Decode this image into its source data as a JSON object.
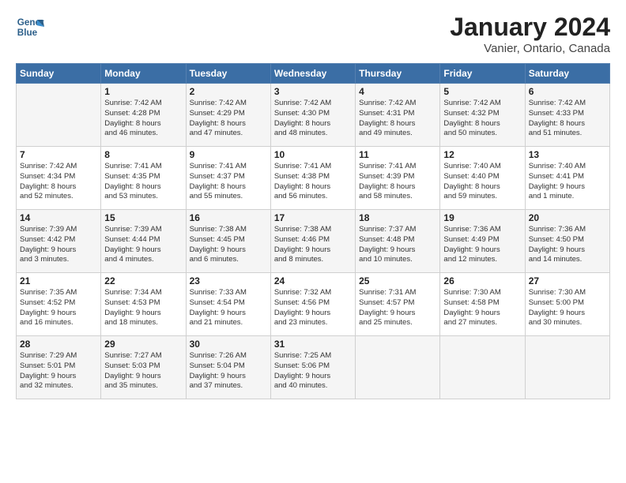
{
  "header": {
    "logo_line1": "General",
    "logo_line2": "Blue",
    "month": "January 2024",
    "location": "Vanier, Ontario, Canada"
  },
  "columns": [
    "Sunday",
    "Monday",
    "Tuesday",
    "Wednesday",
    "Thursday",
    "Friday",
    "Saturday"
  ],
  "weeks": [
    [
      {
        "day": "",
        "info": ""
      },
      {
        "day": "1",
        "info": "Sunrise: 7:42 AM\nSunset: 4:28 PM\nDaylight: 8 hours\nand 46 minutes."
      },
      {
        "day": "2",
        "info": "Sunrise: 7:42 AM\nSunset: 4:29 PM\nDaylight: 8 hours\nand 47 minutes."
      },
      {
        "day": "3",
        "info": "Sunrise: 7:42 AM\nSunset: 4:30 PM\nDaylight: 8 hours\nand 48 minutes."
      },
      {
        "day": "4",
        "info": "Sunrise: 7:42 AM\nSunset: 4:31 PM\nDaylight: 8 hours\nand 49 minutes."
      },
      {
        "day": "5",
        "info": "Sunrise: 7:42 AM\nSunset: 4:32 PM\nDaylight: 8 hours\nand 50 minutes."
      },
      {
        "day": "6",
        "info": "Sunrise: 7:42 AM\nSunset: 4:33 PM\nDaylight: 8 hours\nand 51 minutes."
      }
    ],
    [
      {
        "day": "7",
        "info": "Sunrise: 7:42 AM\nSunset: 4:34 PM\nDaylight: 8 hours\nand 52 minutes."
      },
      {
        "day": "8",
        "info": "Sunrise: 7:41 AM\nSunset: 4:35 PM\nDaylight: 8 hours\nand 53 minutes."
      },
      {
        "day": "9",
        "info": "Sunrise: 7:41 AM\nSunset: 4:37 PM\nDaylight: 8 hours\nand 55 minutes."
      },
      {
        "day": "10",
        "info": "Sunrise: 7:41 AM\nSunset: 4:38 PM\nDaylight: 8 hours\nand 56 minutes."
      },
      {
        "day": "11",
        "info": "Sunrise: 7:41 AM\nSunset: 4:39 PM\nDaylight: 8 hours\nand 58 minutes."
      },
      {
        "day": "12",
        "info": "Sunrise: 7:40 AM\nSunset: 4:40 PM\nDaylight: 8 hours\nand 59 minutes."
      },
      {
        "day": "13",
        "info": "Sunrise: 7:40 AM\nSunset: 4:41 PM\nDaylight: 9 hours\nand 1 minute."
      }
    ],
    [
      {
        "day": "14",
        "info": "Sunrise: 7:39 AM\nSunset: 4:42 PM\nDaylight: 9 hours\nand 3 minutes."
      },
      {
        "day": "15",
        "info": "Sunrise: 7:39 AM\nSunset: 4:44 PM\nDaylight: 9 hours\nand 4 minutes."
      },
      {
        "day": "16",
        "info": "Sunrise: 7:38 AM\nSunset: 4:45 PM\nDaylight: 9 hours\nand 6 minutes."
      },
      {
        "day": "17",
        "info": "Sunrise: 7:38 AM\nSunset: 4:46 PM\nDaylight: 9 hours\nand 8 minutes."
      },
      {
        "day": "18",
        "info": "Sunrise: 7:37 AM\nSunset: 4:48 PM\nDaylight: 9 hours\nand 10 minutes."
      },
      {
        "day": "19",
        "info": "Sunrise: 7:36 AM\nSunset: 4:49 PM\nDaylight: 9 hours\nand 12 minutes."
      },
      {
        "day": "20",
        "info": "Sunrise: 7:36 AM\nSunset: 4:50 PM\nDaylight: 9 hours\nand 14 minutes."
      }
    ],
    [
      {
        "day": "21",
        "info": "Sunrise: 7:35 AM\nSunset: 4:52 PM\nDaylight: 9 hours\nand 16 minutes."
      },
      {
        "day": "22",
        "info": "Sunrise: 7:34 AM\nSunset: 4:53 PM\nDaylight: 9 hours\nand 18 minutes."
      },
      {
        "day": "23",
        "info": "Sunrise: 7:33 AM\nSunset: 4:54 PM\nDaylight: 9 hours\nand 21 minutes."
      },
      {
        "day": "24",
        "info": "Sunrise: 7:32 AM\nSunset: 4:56 PM\nDaylight: 9 hours\nand 23 minutes."
      },
      {
        "day": "25",
        "info": "Sunrise: 7:31 AM\nSunset: 4:57 PM\nDaylight: 9 hours\nand 25 minutes."
      },
      {
        "day": "26",
        "info": "Sunrise: 7:30 AM\nSunset: 4:58 PM\nDaylight: 9 hours\nand 27 minutes."
      },
      {
        "day": "27",
        "info": "Sunrise: 7:30 AM\nSunset: 5:00 PM\nDaylight: 9 hours\nand 30 minutes."
      }
    ],
    [
      {
        "day": "28",
        "info": "Sunrise: 7:29 AM\nSunset: 5:01 PM\nDaylight: 9 hours\nand 32 minutes."
      },
      {
        "day": "29",
        "info": "Sunrise: 7:27 AM\nSunset: 5:03 PM\nDaylight: 9 hours\nand 35 minutes."
      },
      {
        "day": "30",
        "info": "Sunrise: 7:26 AM\nSunset: 5:04 PM\nDaylight: 9 hours\nand 37 minutes."
      },
      {
        "day": "31",
        "info": "Sunrise: 7:25 AM\nSunset: 5:06 PM\nDaylight: 9 hours\nand 40 minutes."
      },
      {
        "day": "",
        "info": ""
      },
      {
        "day": "",
        "info": ""
      },
      {
        "day": "",
        "info": ""
      }
    ]
  ]
}
